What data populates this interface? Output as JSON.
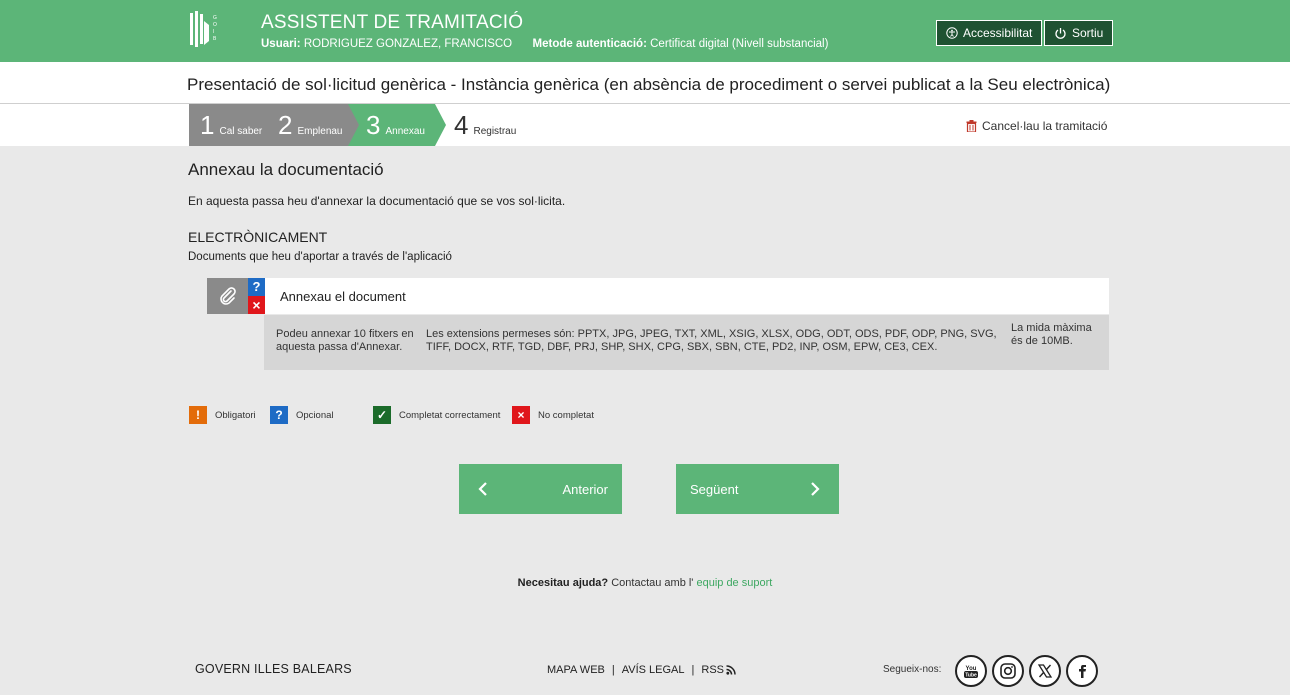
{
  "header": {
    "logo_text": "GOIB",
    "app_title": "ASSISTENT DE TRAMITACIÓ",
    "user_label": "Usuari:",
    "user_name": "RODRIGUEZ GONZALEZ, FRANCISCO",
    "auth_label": "Metode autenticació:",
    "auth_value": "Certificat digital (Nivell substancial)",
    "accessibility_label": "Accessibilitat",
    "exit_label": "Sortiu"
  },
  "procedure_title": "Presentació de sol·licitud genèrica - Instància genèrica (en absència de procediment o servei publicat a la Seu electrònica)",
  "steps": [
    {
      "num": "1",
      "label": "Cal saber"
    },
    {
      "num": "2",
      "label": "Emplenau"
    },
    {
      "num": "3",
      "label": "Annexau"
    },
    {
      "num": "4",
      "label": "Registrau"
    }
  ],
  "cancel_label": "Cancel·lau la tramitació",
  "main": {
    "title": "Annexau la documentació",
    "intro": "En aquesta passa heu d'annexar la documentació que se vos sol·licita.",
    "section_title": "ELECTRÒNICAMENT",
    "section_desc": "Documents que heu d'aportar a través de l'aplicació",
    "doc_label": "Annexau el document",
    "optional_mark": "?",
    "not_completed_mark": "×",
    "info_files": "Podeu annexar 10 fitxers en aquesta passa d'Annexar.",
    "info_extensions": "Les extensions permeses són: PPTX, JPG, JPEG, TXT, XML, XSIG, XLSX, ODG, ODT, ODS, PDF, ODP, PNG, SVG, TIFF, DOCX, RTF, TGD, DBF, PRJ, SHP, SHX, CPG, SBX, SBN, CTE, PD2, INP, OSM, EPW, CE3, CEX.",
    "info_size": "La mida màxima és de 10MB."
  },
  "legend": [
    {
      "mark": "!",
      "label": "Obligatori",
      "color": "#e36c0a"
    },
    {
      "mark": "?",
      "label": "Opcional",
      "color": "#1e6bc5"
    },
    {
      "mark": "✓",
      "label": "Completat correctament",
      "color": "#1b6b2a"
    },
    {
      "mark": "×",
      "label": "No completat",
      "color": "#e0161b"
    }
  ],
  "nav": {
    "prev_label": "Anterior",
    "next_label": "Següent"
  },
  "help": {
    "question": "Necesitau ajuda?",
    "text": " Contactau amb l' ",
    "link": "equip de suport"
  },
  "footer": {
    "brand": "GOVERN ILLES BALEARS",
    "map": "MAPA WEB",
    "legal": "AVÍS LEGAL",
    "rss": "RSS",
    "follow": "Segueix-nos:"
  },
  "colors": {
    "brand_green": "#5cb578",
    "dark_green": "#1f5232",
    "step_gray": "#8a8a8a",
    "background": "#e9e9e9"
  }
}
